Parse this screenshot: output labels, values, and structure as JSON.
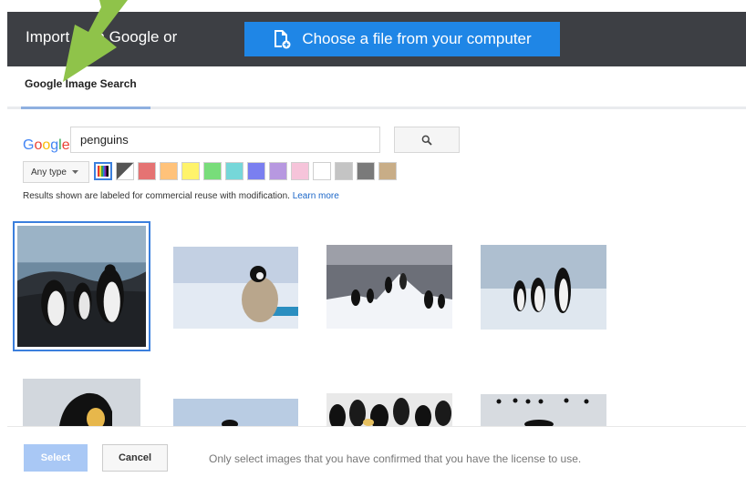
{
  "header": {
    "import_text": "Import from Google or",
    "choose_button_label": "Choose a file from your computer",
    "choose_button_icon": "file-upload-icon",
    "background_color": "#3d3f44",
    "button_color": "#1f86e6"
  },
  "tabs": [
    {
      "label": "Google Image Search",
      "active": true
    }
  ],
  "search": {
    "logo_letters": [
      "G",
      "o",
      "o",
      "g",
      "l",
      "e"
    ],
    "logo_colors": [
      "#4285f4",
      "#ea4335",
      "#fbbc05",
      "#4285f4",
      "#34a853",
      "#ea4335"
    ],
    "query": "penguins",
    "button_icon": "search-icon"
  },
  "filters": {
    "type_label": "Any type",
    "type_dropdown_icon": "caret-down-icon",
    "color_swatches": [
      {
        "name": "full-color",
        "color": "rainbow"
      },
      {
        "name": "black-and-white",
        "color": "diagonal"
      },
      {
        "name": "red",
        "color": "#e57373"
      },
      {
        "name": "orange",
        "color": "#ffc27a"
      },
      {
        "name": "yellow",
        "color": "#fff36a"
      },
      {
        "name": "green",
        "color": "#78dd7a"
      },
      {
        "name": "teal",
        "color": "#76d7d9"
      },
      {
        "name": "blue",
        "color": "#7a7ff0"
      },
      {
        "name": "purple",
        "color": "#b798e0"
      },
      {
        "name": "pink",
        "color": "#f6c4da"
      },
      {
        "name": "white",
        "color": "#ffffff"
      },
      {
        "name": "gray",
        "color": "#c4c4c4"
      },
      {
        "name": "black",
        "color": "#7a7a7a"
      },
      {
        "name": "brown",
        "color": "#c8ad87"
      }
    ]
  },
  "license_note": {
    "text": "Results shown are labeled for commercial reuse with modification.",
    "link": "Learn more"
  },
  "results": [
    {
      "name": "penguin-group-on-beach",
      "selected": true
    },
    {
      "name": "penguin-chick-on-ice",
      "selected": false
    },
    {
      "name": "penguins-on-snow-mound",
      "selected": false
    },
    {
      "name": "emperor-penguins-on-ice",
      "selected": false
    },
    {
      "name": "penguin-closeup-partial",
      "selected": false
    },
    {
      "name": "penguin-on-ice-partial",
      "selected": false
    },
    {
      "name": "penguin-colony-partial",
      "selected": false
    },
    {
      "name": "penguin-distant-partial",
      "selected": false
    }
  ],
  "footer": {
    "select_label": "Select",
    "cancel_label": "Cancel",
    "note": "Only select images that you have confirmed that you have the license to use."
  }
}
